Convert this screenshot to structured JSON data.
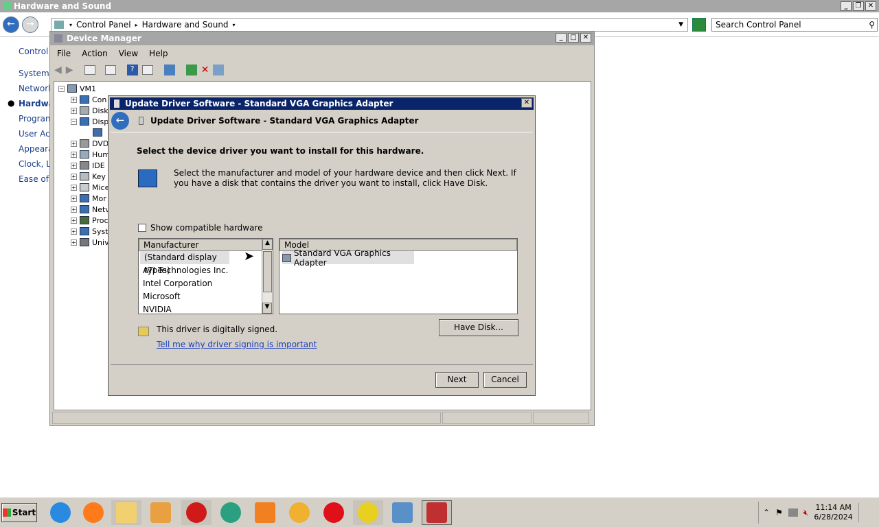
{
  "cp": {
    "title": "Hardware and Sound",
    "breadcrumb": [
      "Control Panel",
      "Hardware and Sound"
    ],
    "search_placeholder": "Search Control Panel",
    "left_links": [
      "Control P",
      "System a",
      "Network",
      "Hardwa",
      "Programs",
      "User Acc",
      "Appearar",
      "Clock, La",
      "Ease of A"
    ],
    "active_link_index": 3
  },
  "dm": {
    "title": "Device Manager",
    "menu": [
      "File",
      "Action",
      "View",
      "Help"
    ],
    "root": "VM1",
    "tree_items": [
      "Con",
      "Disk",
      "Disp",
      "",
      "DVD",
      "Hum",
      "IDE",
      "Key",
      "Mice",
      "Mor",
      "Netv",
      "Proc",
      "Syst",
      "Univ"
    ]
  },
  "dialog": {
    "title": "Update Driver Software - Standard VGA Graphics Adapter",
    "header": "Update Driver Software - Standard VGA Graphics Adapter",
    "instruction": "Select the device driver you want to install for this hardware.",
    "description": "Select the manufacturer and model of your hardware device and then click Next. If you have a disk that contains the driver you want to install, click Have Disk.",
    "show_compatible_label": "Show compatible hardware",
    "show_compatible_checked": false,
    "manufacturer_header": "Manufacturer",
    "manufacturers": [
      "(Standard display types)",
      "ATI Technologies Inc.",
      "Intel Corporation",
      "Microsoft",
      "NVIDIA"
    ],
    "selected_manufacturer": 0,
    "model_header": "Model",
    "models": [
      "Standard VGA Graphics Adapter"
    ],
    "signed_text": "This driver is digitally signed.",
    "signing_link": "Tell me why driver signing is important",
    "have_disk": "Have Disk...",
    "next": "Next",
    "cancel": "Cancel"
  },
  "taskbar": {
    "start": "Start",
    "apps": [
      "internet-explorer-icon",
      "firefox-icon",
      "folder-icon",
      "media-player-icon",
      "opera-red-icon",
      "chat-app-icon",
      "vlc-icon",
      "weather-app-icon",
      "opera-icon",
      "xampp-icon",
      "control-panel-icon",
      "toolbox-icon"
    ],
    "time": "11:14 AM",
    "date": "6/28/2024"
  }
}
